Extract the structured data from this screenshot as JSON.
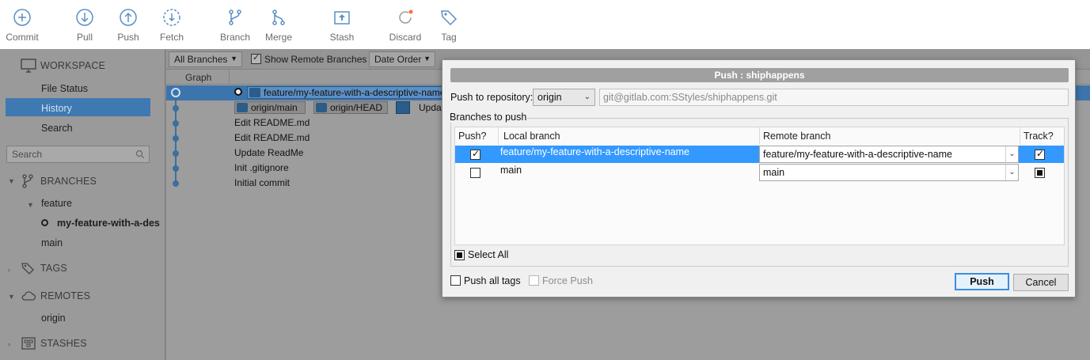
{
  "toolbar": {
    "buttons": [
      {
        "label": "Commit",
        "icon": "plus-circle-icon"
      },
      {
        "label": "Pull",
        "icon": "arrow-down-circle-icon"
      },
      {
        "label": "Push",
        "icon": "arrow-up-circle-icon"
      },
      {
        "label": "Fetch",
        "icon": "fetch-dashed-circle-icon"
      },
      {
        "label": "Branch",
        "icon": "branch-icon"
      },
      {
        "label": "Merge",
        "icon": "merge-icon"
      },
      {
        "label": "Stash",
        "icon": "stash-icon"
      },
      {
        "label": "Discard",
        "icon": "discard-icon"
      },
      {
        "label": "Tag",
        "icon": "tag-icon"
      }
    ]
  },
  "sidebar": {
    "workspace": "WORKSPACE",
    "workspace_items": [
      "File Status",
      "History",
      "Search"
    ],
    "selected": "History",
    "search_placeholder": "Search",
    "branches": "BRANCHES",
    "branch_folder": "feature",
    "branch_current": "my-feature-with-a-des",
    "branch_main": "main",
    "tags": "TAGS",
    "remotes": "REMOTES",
    "remote_origin": "origin",
    "stashes": "STASHES"
  },
  "history": {
    "filter_branches": "All Branches",
    "show_remote": "Show Remote Branches",
    "order": "Date Order",
    "graph_header": "Graph",
    "selected_branch_tag": "feature/my-feature-with-a-descriptive-name",
    "row2_tags": [
      "origin/main",
      "origin/HEAD"
    ],
    "row2_text": "Upda",
    "commits": [
      "Edit README.md",
      "Edit README.md",
      "Update ReadMe",
      "Init .gitignore",
      "Initial commit"
    ]
  },
  "dialog": {
    "title": "Push : shiphappens",
    "repo_label": "Push to repository:",
    "repo_value": "origin",
    "repo_url": "git@gitlab.com:SStyles/shiphappens.git",
    "group_label": "Branches to push",
    "columns": {
      "push": "Push?",
      "local": "Local branch",
      "remote": "Remote branch",
      "track": "Track?"
    },
    "rows": [
      {
        "push": true,
        "local": "feature/my-feature-with-a-descriptive-name",
        "remote": "feature/my-feature-with-a-descriptive-name",
        "track": "checked"
      },
      {
        "push": false,
        "local": "main",
        "remote": "main",
        "track": "indeterminate"
      }
    ],
    "select_all": "Select All",
    "push_all_tags": "Push all tags",
    "force_push": "Force Push",
    "push_button": "Push",
    "cancel_button": "Cancel"
  },
  "colors": {
    "selection_blue": "#3399ff",
    "default_button_border": "#3c8ee0",
    "history_selection": "#3c74ac"
  }
}
